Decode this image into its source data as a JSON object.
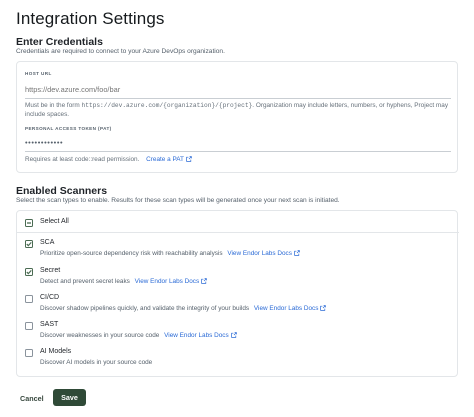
{
  "page": {
    "title": "Integration Settings"
  },
  "credentials": {
    "heading": "Enter Credentials",
    "description": "Credentials are required to connect to your Azure DevOps organization.",
    "host_url": {
      "label": "HOST URL",
      "placeholder": "https://dev.azure.com/foo/bar",
      "help_prefix": "Must be in the form ",
      "help_code": "https://dev.azure.com/{organization}/{project}",
      "help_suffix": ". Organization may include letters, numbers, or hyphens, Project may include spaces."
    },
    "token": {
      "label": "PERSONAL ACCESS TOKEN (PAT)",
      "value": "••••••••••••",
      "help": "Requires at least code::read permission.",
      "link": "Create a PAT"
    }
  },
  "scanners": {
    "heading": "Enabled Scanners",
    "description": "Select the scan types to enable. Results for these scan types will be generated once your next scan is initiated.",
    "select_all": {
      "label": "Select All",
      "state": "indeterminate"
    },
    "items": [
      {
        "name": "SCA",
        "description": "Prioritize open-source dependency risk with reachability analysis",
        "link": "View Endor Labs Docs",
        "checked": true
      },
      {
        "name": "Secret",
        "description": "Detect and prevent secret leaks",
        "link": "View Endor Labs Docs",
        "checked": true
      },
      {
        "name": "CI/CD",
        "description": "Discover shadow pipelines quickly, and validate the integrity of your builds",
        "link": "View Endor Labs Docs",
        "checked": false
      },
      {
        "name": "SAST",
        "description": "Discover weaknesses in your source code",
        "link": "View Endor Labs Docs",
        "checked": false
      },
      {
        "name": "AI Models",
        "description": "Discover AI models in your source code",
        "link": "",
        "checked": false
      }
    ]
  },
  "actions": {
    "cancel": "Cancel",
    "save": "Save"
  },
  "colors": {
    "primary": "#2f4a37",
    "link": "#2a6ad6",
    "check": "#4a6b52"
  }
}
